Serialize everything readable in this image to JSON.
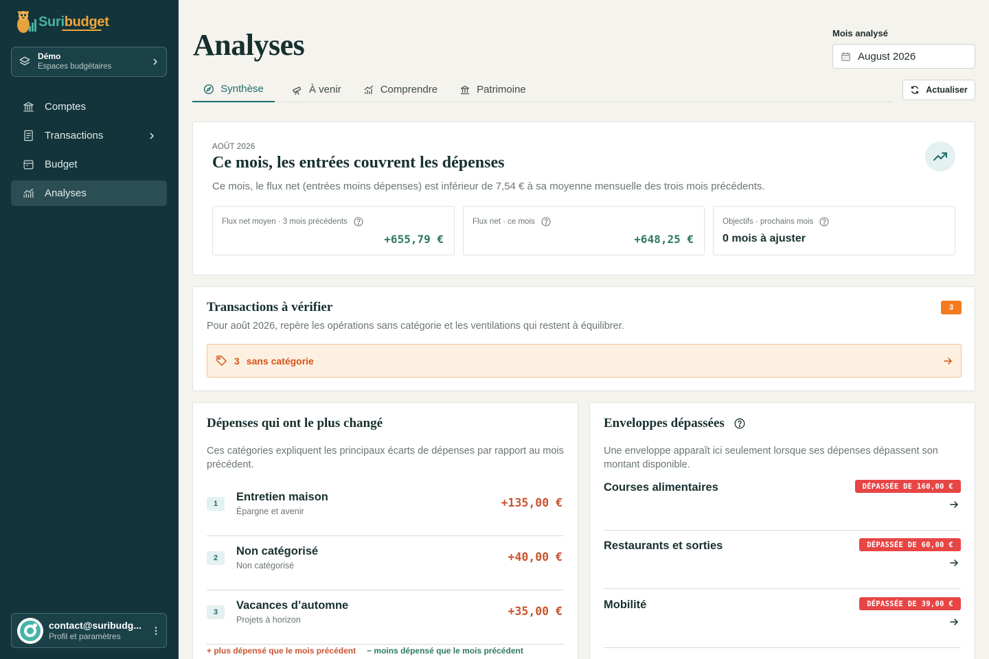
{
  "brand": {
    "name_part1": "Suri",
    "name_part2": "budget",
    "accent": "#48b3a8",
    "accent2": "#f0a53a"
  },
  "space": {
    "name": "Démo",
    "subtitle": "Espaces budgétaires",
    "icon": "layers-icon"
  },
  "nav": {
    "items": [
      {
        "label": "Comptes",
        "icon": "bank-icon",
        "active": false
      },
      {
        "label": "Transactions",
        "icon": "receipt-icon",
        "active": false,
        "has_children": true
      },
      {
        "label": "Budget",
        "icon": "wallet-icon",
        "active": false
      },
      {
        "label": "Analyses",
        "icon": "chart-icon",
        "active": true
      }
    ]
  },
  "profile": {
    "email": "contact@suribudg...",
    "subtitle": "Profil et paramètres"
  },
  "page": {
    "title": "Analyses"
  },
  "month": {
    "label": "Mois analysé",
    "value": "August 2026"
  },
  "tabs": [
    {
      "label": "Synthèse",
      "icon": "compass-icon",
      "active": true
    },
    {
      "label": "À venir",
      "icon": "telescope-icon",
      "active": false
    },
    {
      "label": "Comprendre",
      "icon": "chart-icon",
      "active": false
    },
    {
      "label": "Patrimoine",
      "icon": "bank-icon",
      "active": false
    }
  ],
  "refresh": {
    "label": "Actualiser"
  },
  "summary": {
    "eyebrow": "AOÛT 2026",
    "headline": "Ce mois, les entrées couvrent les dépenses",
    "description": "Ce mois, le flux net (entrées moins dépenses) est inférieur de 7,54 € à sa moyenne mensuelle des trois mois précédents.",
    "kpis": [
      {
        "label": "Flux net moyen · 3 mois précédents",
        "value": "+655,79 €"
      },
      {
        "label": "Flux net · ce mois",
        "value": "+648,25 €"
      },
      {
        "label": "Objectifs · prochains mois",
        "value": "0 mois à ajuster"
      }
    ]
  },
  "review": {
    "title": "Transactions à vérifier",
    "count": "3",
    "description": "Pour août 2026, repère les opérations sans catégorie et les ventilations qui restent à équilibrer.",
    "alert": {
      "count": "3",
      "label": "sans catégorie"
    }
  },
  "changes": {
    "title": "Dépenses qui ont le plus changé",
    "description": "Ces catégories expliquent les principaux écarts de dépenses par rapport au mois précédent.",
    "rows": [
      {
        "rank": "1",
        "name": "Entretien maison",
        "group": "Épargne et avenir",
        "delta": "+135,00 €"
      },
      {
        "rank": "2",
        "name": "Non catégorisé",
        "group": "Non catégorisé",
        "delta": "+40,00 €"
      },
      {
        "rank": "3",
        "name": "Vacances d’automne",
        "group": "Projets à horizon",
        "delta": "+35,00 €"
      }
    ],
    "legend_up": "+ plus dépensé que le mois précédent",
    "legend_down": "− moins dépensé que le mois précédent"
  },
  "envelopes": {
    "title": "Enveloppes dépassées",
    "description": "Une enveloppe apparaît ici seulement lorsque ses dépenses dépassent son montant disponible.",
    "rows": [
      {
        "name": "Courses alimentaires",
        "badge": "DÉPASSÉE DE 160,00 €"
      },
      {
        "name": "Restaurants et sorties",
        "badge": "DÉPASSÉE DE 60,00 €"
      },
      {
        "name": "Mobilité",
        "badge": "DÉPASSÉE DE 39,00 €"
      }
    ]
  }
}
